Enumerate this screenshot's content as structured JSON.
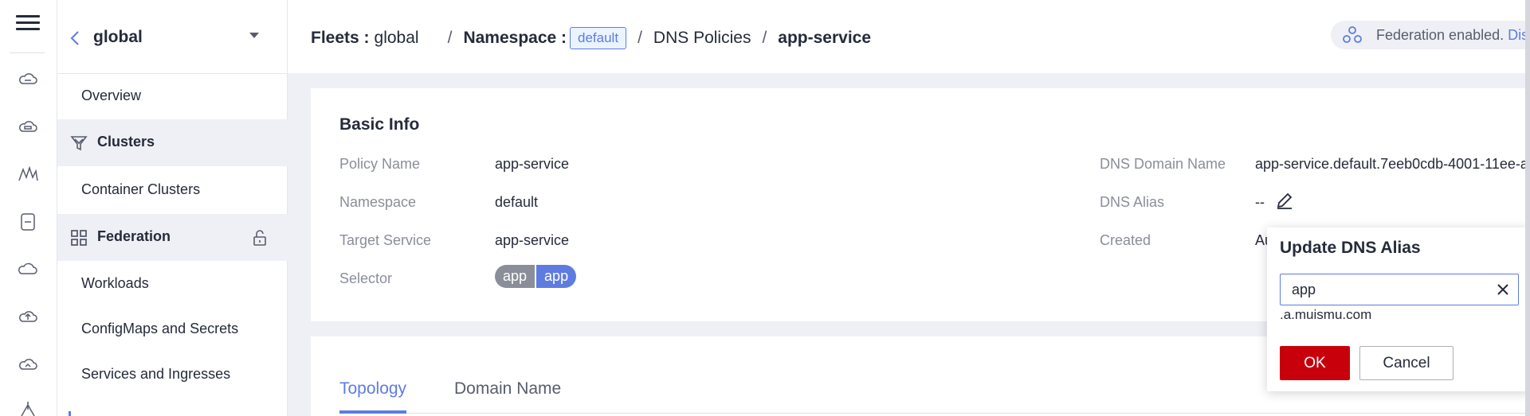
{
  "rail": {
    "icons": [
      "menu-icon",
      "cloud-icon",
      "cloud-storage-icon",
      "mountain-icon",
      "device-icon",
      "cloud-outline-icon",
      "cloud-upload-icon",
      "cloud-sync-icon",
      "network-icon"
    ]
  },
  "nav": {
    "title": "global",
    "items": [
      {
        "label": "Overview"
      },
      {
        "label": "Clusters"
      },
      {
        "label": "Container Clusters"
      },
      {
        "label": "Federation"
      },
      {
        "label": "Workloads"
      },
      {
        "label": "ConfigMaps and Secrets"
      },
      {
        "label": "Services and Ingresses"
      }
    ]
  },
  "breadcrumb": {
    "fleets_label": "Fleets :",
    "fleets_value": "global",
    "namespace_label": "Namespace :",
    "namespace_value": "default",
    "dns_policies": "DNS Policies",
    "current": "app-service",
    "separator": "/"
  },
  "federation": {
    "text": "Federation enabled.",
    "link": "Dis"
  },
  "basic_info": {
    "title": "Basic Info",
    "policy_name_label": "Policy Name",
    "policy_name_value": "app-service",
    "namespace_label": "Namespace",
    "namespace_value": "default",
    "target_service_label": "Target Service",
    "target_service_value": "app-service",
    "selector_label": "Selector",
    "selector_key": "app",
    "selector_value": "app",
    "dns_domain_label": "DNS Domain Name",
    "dns_domain_value": "app-service.default.7eeb0cdb-4001-11ee-a",
    "dns_alias_label": "DNS Alias",
    "dns_alias_value": "--",
    "created_label": "Created",
    "created_value": "Au"
  },
  "tabs": [
    {
      "label": "Topology",
      "active": true
    },
    {
      "label": "Domain Name",
      "active": false
    }
  ],
  "popover": {
    "title": "Update DNS Alias",
    "input_value": "app",
    "suffix": ".a.muismu.com",
    "ok_label": "OK",
    "cancel_label": "Cancel"
  },
  "colors": {
    "accent": "#5e7ce0",
    "primary_button": "#c7000b",
    "text": "#252b3a",
    "muted": "#8a8e99"
  }
}
